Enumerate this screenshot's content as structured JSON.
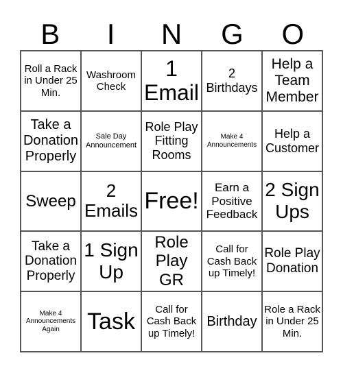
{
  "header": [
    "B",
    "I",
    "N",
    "G",
    "O"
  ],
  "cells": [
    "Roll a Rack in Under 25 Min.",
    "Washroom Check",
    "1 Email",
    "2 Birthdays",
    "Help a Team Member",
    "Take a Donation Properly",
    "Sale Day Announcement",
    "Role Play Fitting Rooms",
    "Make 4 Announcements",
    "Help a Customer",
    "Sweep",
    "2 Emails",
    "Free!",
    "Earn a Positive Feedback",
    "2 Sign Ups",
    "Take a Donation Properly",
    "1 Sign Up",
    "Role Play GR",
    "Call for Cash Back up Timely!",
    "Role Play Donation",
    "Make 4 Announcements Again",
    "Task",
    "Call for Cash Back up Timely!",
    "Birthday",
    "Role a Rack in Under 25 Min."
  ]
}
